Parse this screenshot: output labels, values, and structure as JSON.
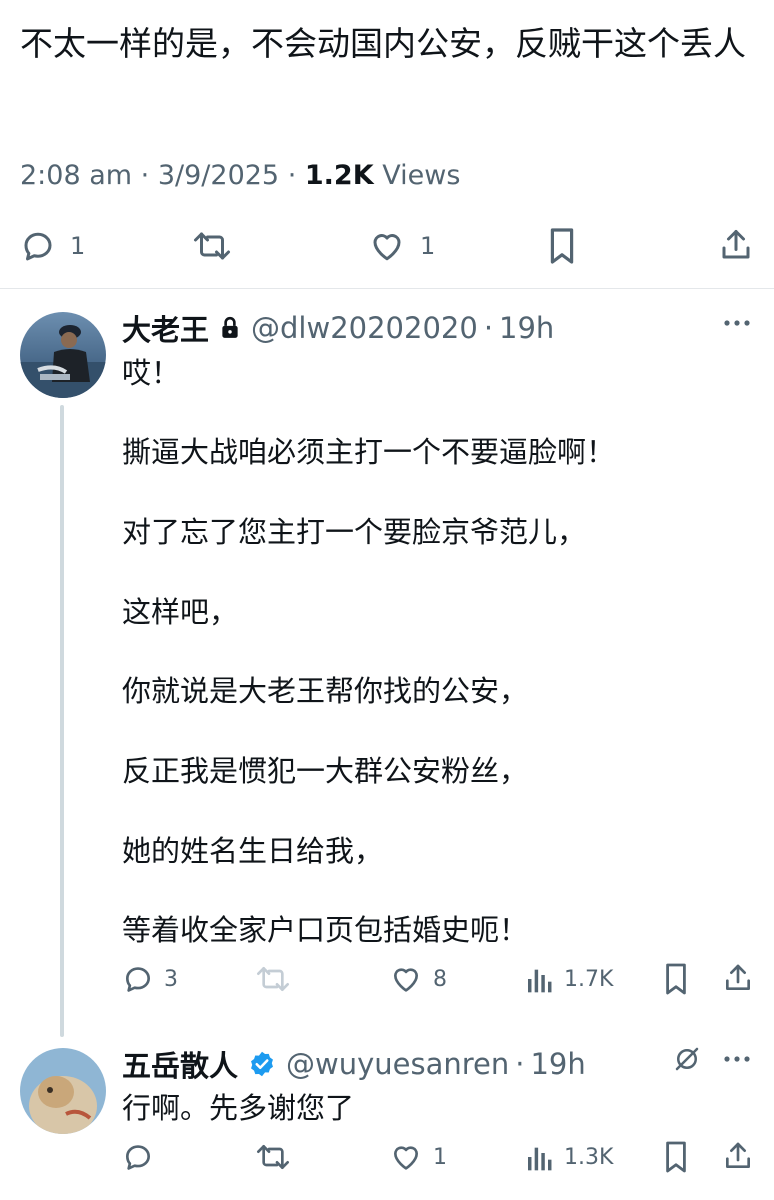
{
  "tweet": {
    "text": "不太一样的是，不会动国内公安，反贼干这个丢人",
    "time": "2:08 am",
    "date": "3/9/2025",
    "views_count": "1.2K",
    "views_label": "Views",
    "separator": "·",
    "reply_count": "1",
    "like_count": "1"
  },
  "replies": [
    {
      "name": "大老王",
      "handle": "@dlw20202020",
      "time": "19h",
      "separator": "·",
      "locked": true,
      "lines": [
        "哎！",
        "撕逼大战咱必须主打一个不要逼脸啊！",
        "对了忘了您主打一个要脸京爷范儿，",
        "这样吧，",
        "你就说是大老王帮你找的公安，",
        "反正我是惯犯一大群公安粉丝，",
        "她的姓名生日给我，",
        "等着收全家户口页包括婚史呃！"
      ],
      "reply_count": "3",
      "like_count": "8",
      "views": "1.7K"
    },
    {
      "name": "五岳散人",
      "handle": "@wuyuesanren",
      "time": "19h",
      "separator": "·",
      "verified": true,
      "verified_color": "#1d9bf0",
      "text": "行啊。先多谢您了",
      "like_count": "1",
      "views": "1.3K"
    }
  ],
  "colors": {
    "text": "#0f1419",
    "secondary": "#536471",
    "divider": "#e4e7ea",
    "thread_line": "#cfd9de",
    "verified": "#1d9bf0"
  }
}
